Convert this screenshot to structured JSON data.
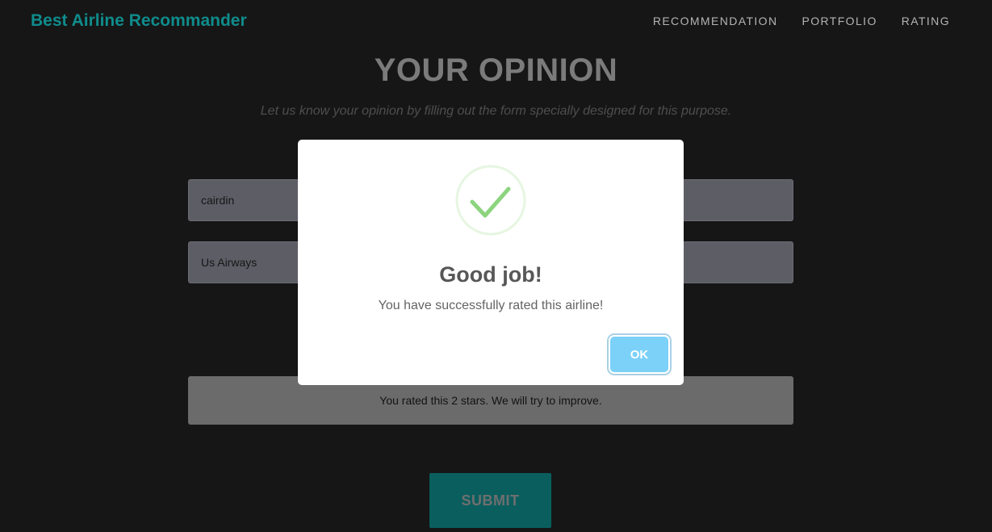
{
  "nav": {
    "brand": "Best Airline Recommander",
    "links": [
      "RECOMMENDATION",
      "PORTFOLIO",
      "RATING"
    ]
  },
  "form": {
    "heading": "YOUR OPINION",
    "subheading": "Let us know your opinion by filling out the form specially designed for this purpose.",
    "name_value": "cairdin",
    "airline_value": "Us Airways",
    "rating_message": "You rated this 2 stars. We will try to improve.",
    "submit_label": "SUBMIT"
  },
  "modal": {
    "icon": "success-check-icon",
    "title": "Good job!",
    "text": "You have successfully rated this airline!",
    "ok_label": "OK"
  },
  "colors": {
    "brand": "#0f8c8c",
    "submit": "#0a5e5e",
    "ok_button": "#7cd1f9",
    "success": "#8cd47e"
  }
}
